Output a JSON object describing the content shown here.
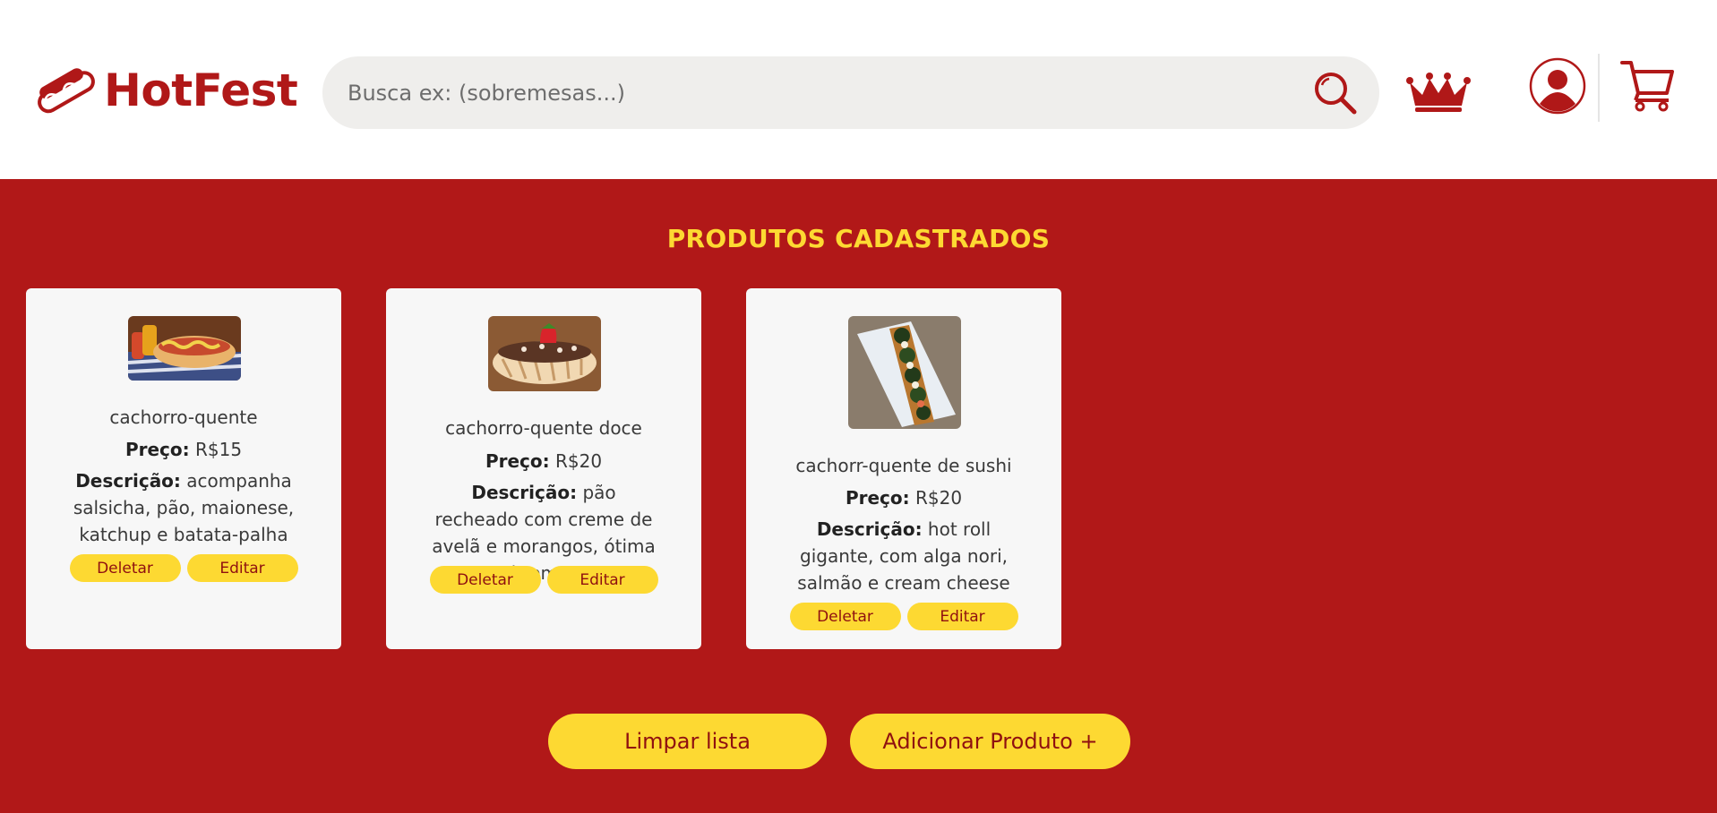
{
  "header": {
    "brand": "HotFest",
    "search": {
      "placeholder": "Busca ex: (sobremesas...)",
      "value": ""
    },
    "icons": [
      "hotdog-logo-icon",
      "search-icon",
      "crown-icon",
      "user-avatar-icon",
      "cart-icon"
    ]
  },
  "main": {
    "title": "PRODUTOS CADASTRADOS",
    "price_label": "Preço:",
    "desc_label": "Descrição:",
    "delete_label": "Deletar",
    "edit_label": "Editar",
    "products": [
      {
        "name": "cachorro-quente",
        "price": "R$15",
        "description": "acompanha salsicha, pão, maionese, katchup e batata-palha",
        "image": "hotdog-photo"
      },
      {
        "name": "cachorro-quente doce",
        "price": "R$20",
        "description": "pão recheado com creme de avelã e morangos, ótima sobremesa!",
        "image": "sweet-hotdog-photo"
      },
      {
        "name": "cachorr-quente de sushi",
        "price": "R$20",
        "description": "hot roll gigante, com alga nori, salmão e cream cheese",
        "image": "sushi-hotdog-photo"
      }
    ],
    "clear_label": "Limpar lista",
    "add_label": "Adicionar Produto +"
  },
  "colors": {
    "brand_red": "#b11818",
    "accent_yellow": "#fdd932",
    "button_text": "#8f1010",
    "card_bg": "#f7f7f7",
    "search_bg": "#efeeec"
  }
}
